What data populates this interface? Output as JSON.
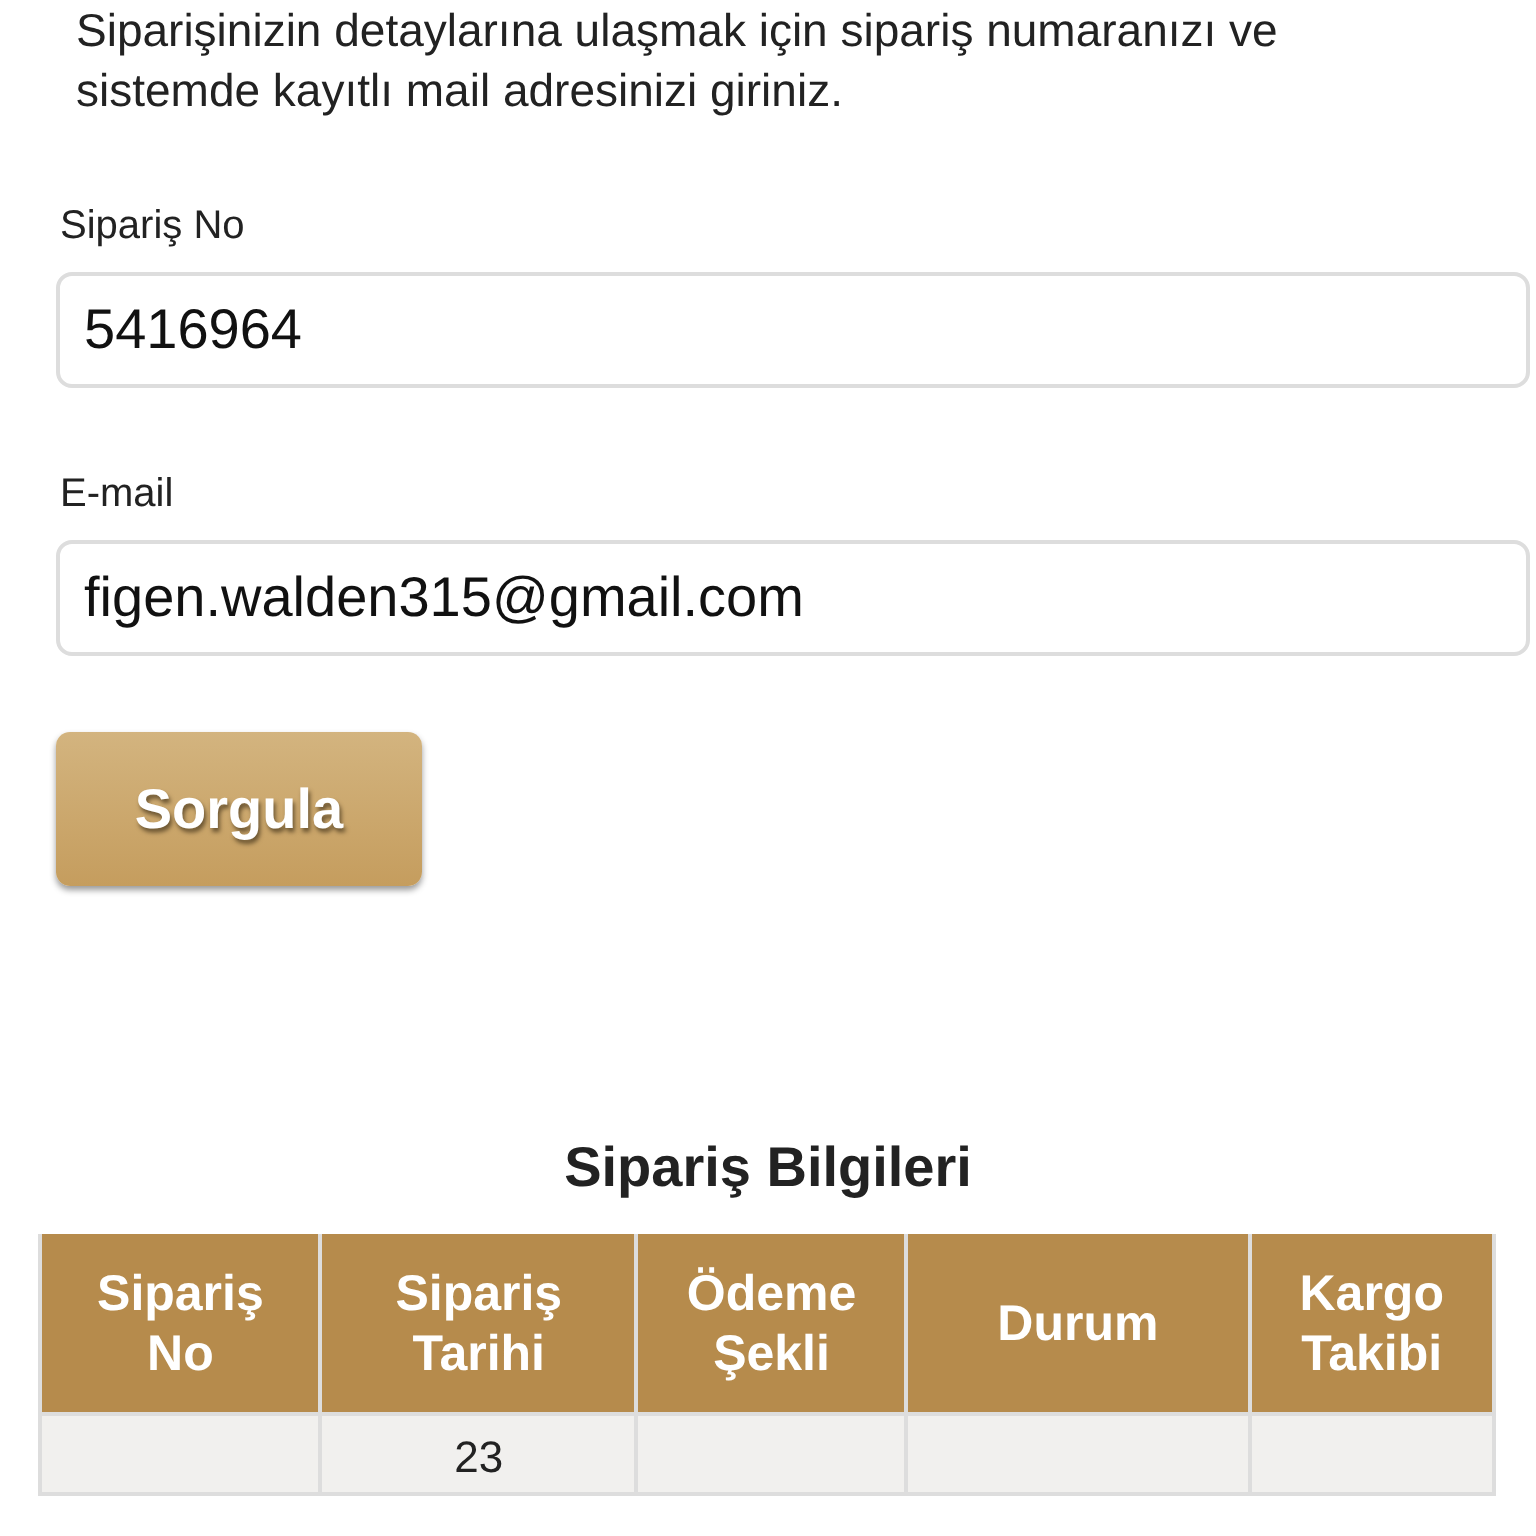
{
  "intro": "Siparişinizin detaylarına ulaşmak için sipariş numaranızı ve sistemde kayıtlı mail adresinizi giriniz.",
  "fields": [
    {
      "label": "Sipariş No",
      "value": "5416964"
    },
    {
      "label": "E-mail",
      "value": "figen.walden315@gmail.com"
    }
  ],
  "button": "Sorgula",
  "table": {
    "title": "Sipariş Bilgileri",
    "columns": [
      "Sipariş No",
      "Sipariş Tarihi",
      "Ödeme Şekli",
      "Durum",
      "Kargo Takibi"
    ],
    "rows": [
      [
        "",
        "23",
        "",
        "",
        ""
      ]
    ]
  }
}
